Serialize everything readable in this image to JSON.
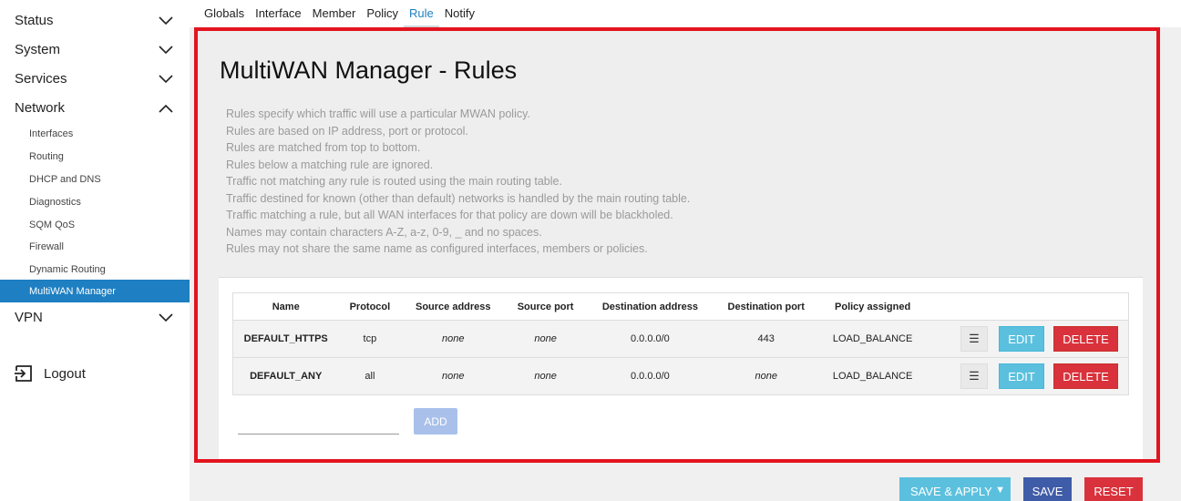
{
  "sidebar": {
    "main": [
      {
        "label": "Status",
        "icon": "chevron-down-icon"
      },
      {
        "label": "System",
        "icon": "chevron-down-icon"
      },
      {
        "label": "Services",
        "icon": "chevron-down-icon"
      },
      {
        "label": "Network",
        "icon": "chevron-up-icon"
      },
      {
        "label": "VPN",
        "icon": "chevron-down-icon"
      }
    ],
    "network_items": [
      {
        "label": "Interfaces"
      },
      {
        "label": "Routing"
      },
      {
        "label": "DHCP and DNS"
      },
      {
        "label": "Diagnostics"
      },
      {
        "label": "SQM QoS"
      },
      {
        "label": "Firewall"
      },
      {
        "label": "Dynamic Routing"
      },
      {
        "label": "MultiWAN Manager",
        "active": true
      }
    ],
    "logout": "Logout"
  },
  "tabs": [
    {
      "label": "Globals"
    },
    {
      "label": "Interface"
    },
    {
      "label": "Member"
    },
    {
      "label": "Policy"
    },
    {
      "label": "Rule",
      "active": true
    },
    {
      "label": "Notify"
    }
  ],
  "page": {
    "title": "MultiWAN Manager - Rules",
    "description": [
      "Rules specify which traffic will use a particular MWAN policy.",
      "Rules are based on IP address, port or protocol.",
      "Rules are matched from top to bottom.",
      "Rules below a matching rule are ignored.",
      "Traffic not matching any rule is routed using the main routing table.",
      "Traffic destined for known (other than default) networks is handled by the main routing table.",
      "Traffic matching a rule, but all WAN interfaces for that policy are down will be blackholed.",
      "Names may contain characters A-Z, a-z, 0-9, _ and no spaces.",
      "Rules may not share the same name as configured interfaces, members or policies."
    ]
  },
  "table": {
    "headers": [
      "Name",
      "Protocol",
      "Source address",
      "Source port",
      "Destination address",
      "Destination port",
      "Policy assigned"
    ],
    "rows": [
      {
        "name": "DEFAULT_HTTPS",
        "protocol": "tcp",
        "src_addr": "none",
        "src_port": "none",
        "dst_addr": "0.0.0.0/0",
        "dst_port": "443",
        "policy": "LOAD_BALANCE"
      },
      {
        "name": "DEFAULT_ANY",
        "protocol": "all",
        "src_addr": "none",
        "src_port": "none",
        "dst_addr": "0.0.0.0/0",
        "dst_port": "none",
        "policy": "LOAD_BALANCE"
      }
    ],
    "menu_label": "☰",
    "edit_label": "EDIT",
    "delete_label": "DELETE"
  },
  "add": {
    "value": "",
    "button": "ADD"
  },
  "footer": {
    "save_apply": "SAVE & APPLY",
    "save": "SAVE",
    "reset": "RESET"
  },
  "colors": {
    "accent": "#1e7fc2",
    "highlight_border": "#e3141f",
    "edit": "#5bc0de",
    "delete": "#d9323c",
    "save": "#3f5ca8"
  }
}
